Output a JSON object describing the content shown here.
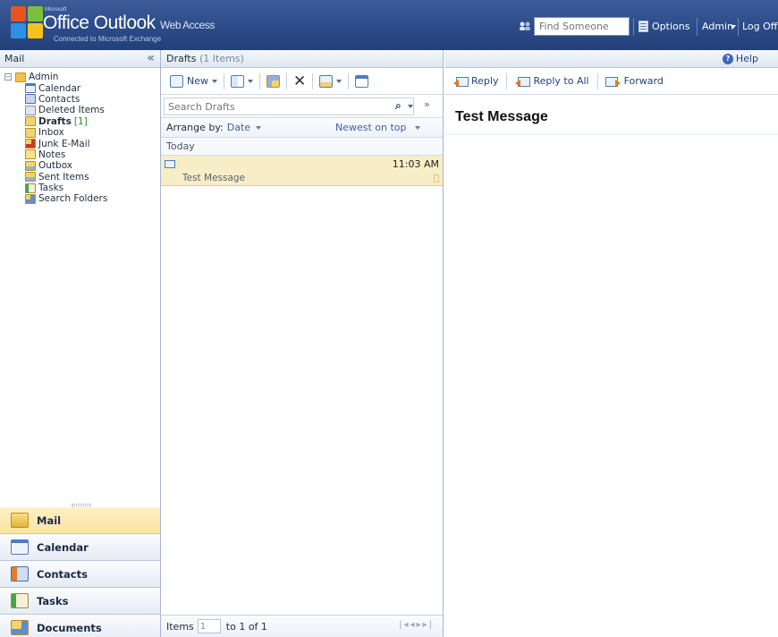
{
  "header": {
    "brand_small": "Microsoft",
    "brand_title": "Office Outlook",
    "brand_suffix": "Web Access",
    "brand_subtitle": "Connected to Microsoft Exchange",
    "find_placeholder": "Find Someone",
    "options_label": "Options",
    "user_label": "Admin",
    "logoff_label": "Log Off"
  },
  "left": {
    "title": "Mail",
    "collapse_glyph": "«",
    "root": "Admin",
    "folders": [
      {
        "label": "Calendar",
        "icon": "calendar-icon"
      },
      {
        "label": "Contacts",
        "icon": "contacts-icon"
      },
      {
        "label": "Deleted Items",
        "icon": "deleted-items-icon"
      },
      {
        "label": "Drafts",
        "icon": "drafts-icon",
        "count": "[1]"
      },
      {
        "label": "Inbox",
        "icon": "inbox-icon"
      },
      {
        "label": "Junk E-Mail",
        "icon": "junk-mail-icon"
      },
      {
        "label": "Notes",
        "icon": "notes-icon"
      },
      {
        "label": "Outbox",
        "icon": "outbox-icon"
      },
      {
        "label": "Sent Items",
        "icon": "sent-items-icon"
      },
      {
        "label": "Tasks",
        "icon": "tasks-icon"
      },
      {
        "label": "Search Folders",
        "icon": "search-folders-icon"
      }
    ],
    "modules": [
      {
        "label": "Mail",
        "active": true
      },
      {
        "label": "Calendar"
      },
      {
        "label": "Contacts"
      },
      {
        "label": "Tasks"
      },
      {
        "label": "Documents"
      }
    ]
  },
  "list": {
    "folder_title": "Drafts",
    "item_count": "(1 Items)",
    "toolbar_new": "New",
    "search_placeholder": "Search Drafts",
    "arrange_label": "Arrange by:",
    "arrange_value": "Date",
    "order_value": "Newest on top",
    "group": "Today",
    "messages": [
      {
        "time": "11:03 AM",
        "subject": "Test Message"
      }
    ],
    "footer_items": "Items",
    "footer_page": "1",
    "footer_range": "to 1 of 1"
  },
  "reading": {
    "help": "Help",
    "reply": "Reply",
    "reply_all": "Reply to All",
    "forward": "Forward",
    "subject": "Test Message"
  },
  "colors": {
    "header_bg": "#2a4a87",
    "selection": "#f7edc6",
    "active_module": "#fbe3a3",
    "link_blue": "#25437a"
  }
}
